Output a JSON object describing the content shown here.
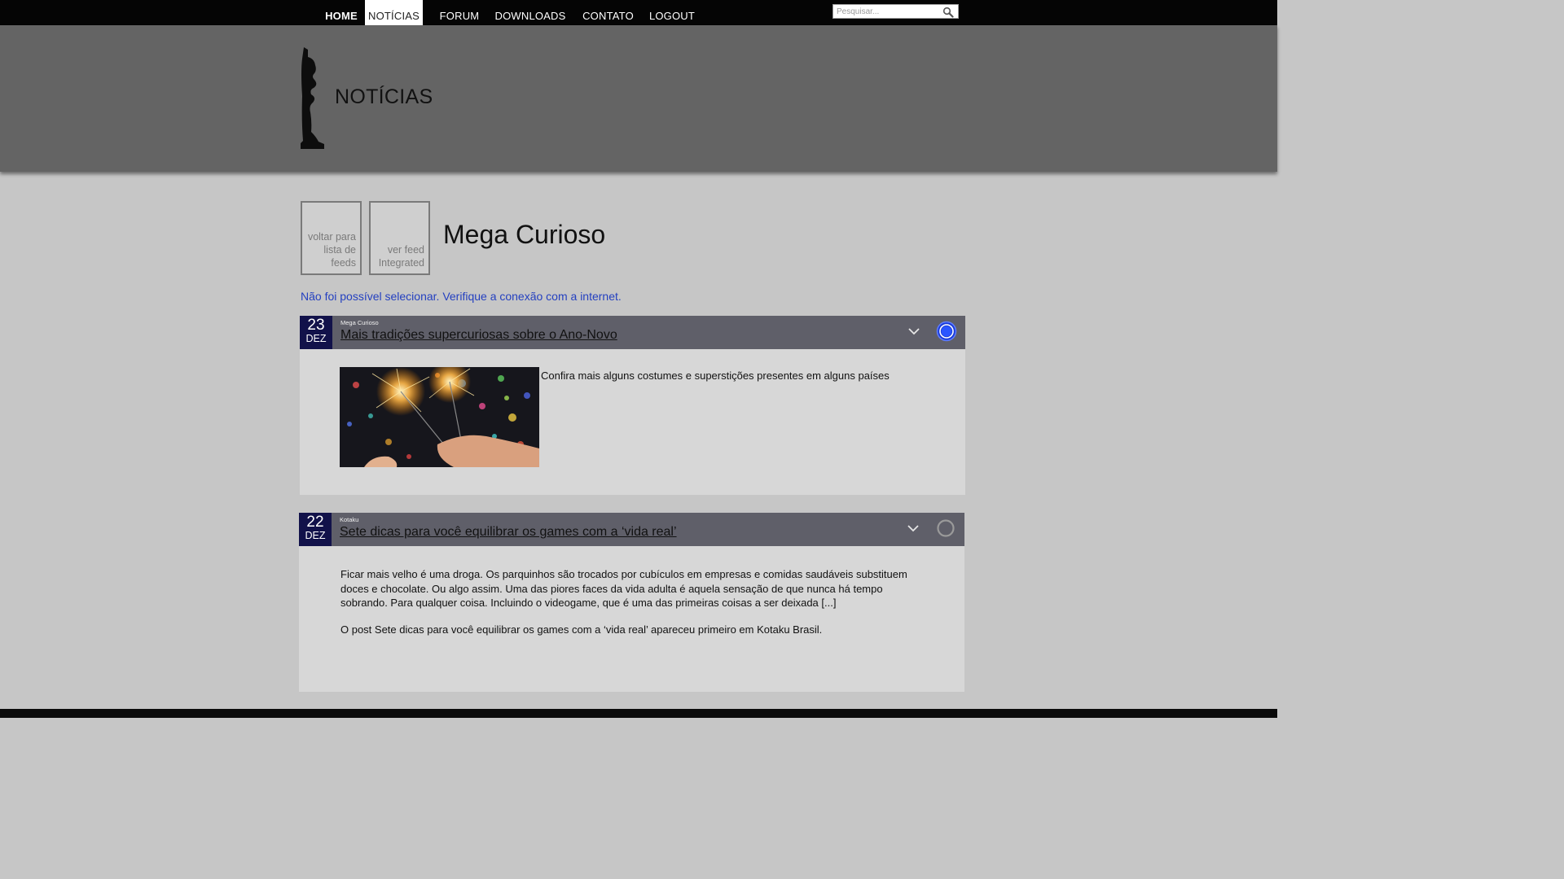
{
  "nav": {
    "items": [
      {
        "label": "HOME"
      },
      {
        "label": "NOTÍCIAS"
      },
      {
        "label": "FORUM"
      },
      {
        "label": "DOWNLOADS"
      },
      {
        "label": "CONTATO"
      },
      {
        "label": "LOGOUT"
      }
    ],
    "active": "NOTÍCIAS",
    "search_placeholder": "Pesquisar...",
    "search_icon": "magnifier-icon"
  },
  "banner": {
    "title": "NOTÍCIAS",
    "logo_icon": "chess-king-silhouette"
  },
  "feed": {
    "back_tile": "voltar para lista de feeds",
    "integrated_tile": "ver feed Integrated",
    "title": "Mega Curioso",
    "error": "Não foi possível selecionar. Verifique a conexão com a internet."
  },
  "articles": [
    {
      "day": "23",
      "month": "DEZ",
      "source": "Mega Curioso",
      "title": "Mais tradições supercuriosas sobre o Ano-Novo",
      "summary": "Confira mais alguns costumes e superstições presentes em alguns países",
      "selected": true,
      "image_icon": "sparklers-photo"
    },
    {
      "day": "22",
      "month": "DEZ",
      "source": "Kotaku",
      "title": "Sete dicas para você equilibrar os games com a ‘vida real’",
      "summary_p1": "Ficar mais velho é uma droga. Os parquinhos são trocados por cubículos em empresas e comidas saudáveis substituem doces e chocolate. Ou algo assim. Uma das piores faces da vida adulta é aquela sensação de que nunca há tempo sobrando. Para qualquer coisa. Incluindo o videogame, que é uma das primeiras coisas a ser deixada [...]",
      "summary_p2": "O post Sete dicas para você equilibrar os games com a ‘vida real’ apareceu primeiro em Kotaku Brasil.",
      "selected": false
    }
  ],
  "colors": {
    "topbar": "#050505",
    "banner": "#646464",
    "card_header": "#5f5f69",
    "date_box": "#12124a",
    "error_text": "#2440c0",
    "radio_selected": "#2a55ff"
  }
}
